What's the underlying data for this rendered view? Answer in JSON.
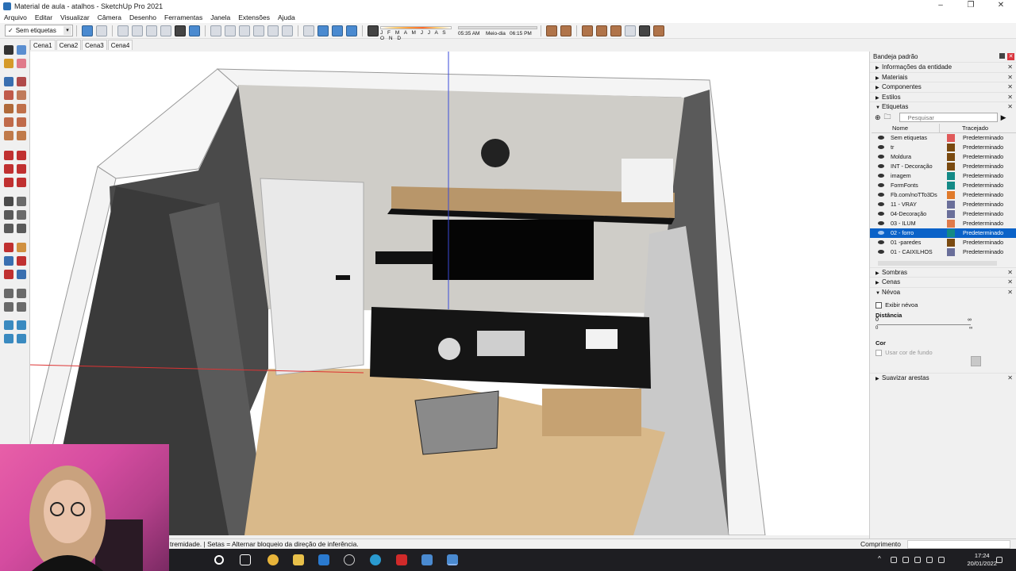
{
  "window": {
    "title": "Material de aula - atalhos - SketchUp Pro 2021"
  },
  "menu": [
    "Arquivo",
    "Editar",
    "Visualizar",
    "Câmera",
    "Desenho",
    "Ferramentas",
    "Janela",
    "Extensões",
    "Ajuda"
  ],
  "toolbar": {
    "tag_select_value": "Sem etiquetas",
    "months": "J F M A M J J A S O N D",
    "time_start": "05:35 AM",
    "time_mid": "Meio-dia",
    "time_end": "06:15 PM"
  },
  "scenes": [
    "Cena1",
    "Cena2",
    "Cena3",
    "Cena4"
  ],
  "tray": {
    "title": "Bandeja padrão",
    "sections_top": [
      "Informações da entidade",
      "Materiais",
      "Componentes",
      "Estilos"
    ],
    "tags_section": "Etiquetas",
    "search_placeholder": "Pesquisar",
    "col_name": "Nome",
    "col_dash": "Tracejado",
    "tags": [
      {
        "name": "Sem etiquetas",
        "color": "#e05a5a",
        "dash": "Predeterminado"
      },
      {
        "name": "tr",
        "color": "#7a4a10",
        "dash": "Predeterminado"
      },
      {
        "name": "Moldura",
        "color": "#7a4a10",
        "dash": "Predeterminado"
      },
      {
        "name": "INT - Decoração",
        "color": "#7a4a10",
        "dash": "Predeterminado"
      },
      {
        "name": "imagem",
        "color": "#138a86",
        "dash": "Predeterminado"
      },
      {
        "name": "FormFonts",
        "color": "#138a86",
        "dash": "Predeterminado"
      },
      {
        "name": "Fb.com/noTTo3Ds",
        "color": "#e07a2a",
        "dash": "Predeterminado"
      },
      {
        "name": "11 - VRAY",
        "color": "#6a6f9a",
        "dash": "Predeterminado"
      },
      {
        "name": "04-Decoração",
        "color": "#6a6f9a",
        "dash": "Predeterminado"
      },
      {
        "name": "03 - ILUM",
        "color": "#e07a4a",
        "dash": "Predeterminado"
      },
      {
        "name": "02 - forro",
        "color": "#138a86",
        "dash": "Predeterminado"
      },
      {
        "name": "01 -paredes",
        "color": "#7a4a10",
        "dash": "Predeterminado"
      },
      {
        "name": "01 - CAIXILHOS",
        "color": "#6a6f9a",
        "dash": "Predeterminado"
      }
    ],
    "selected_tag_index": 10,
    "sections_mid": [
      "Sombras",
      "Cenas"
    ],
    "fog_section": "Névoa",
    "fog": {
      "show_fog": "Exibir névoa",
      "distance_label": "Distância",
      "near": "0",
      "far": "∞",
      "near_small": "0",
      "far_small": "∞",
      "color_label": "Cor",
      "use_bg": "Usar cor de fundo"
    },
    "section_bottom": "Suavizar arestas"
  },
  "status": {
    "message": "tremidade. | Setas = Alternar bloqueio da direção de inferência.",
    "length_label": "Comprimento"
  },
  "taskbar": {
    "time": "17:24",
    "date": "20/01/2022"
  },
  "colors": {
    "selection": "#0a62c8",
    "wall_dark": "#3a3a3a",
    "floor": "#d9b98a",
    "desk": "#1a1a1a"
  }
}
